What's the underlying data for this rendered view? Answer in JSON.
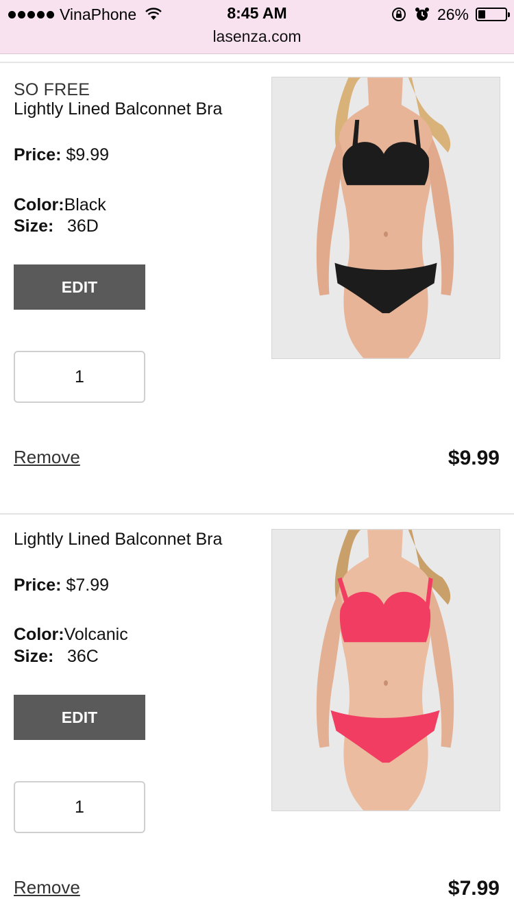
{
  "status_bar": {
    "carrier": "VinaPhone",
    "time": "8:45 AM",
    "battery": "26%",
    "battery_level": 0.26
  },
  "browser": {
    "url": "lasenza.com"
  },
  "cart": {
    "items": [
      {
        "brand": "SO FREE",
        "name": "Lightly Lined Balconnet Bra",
        "price_label": "Price:",
        "price": "$9.99",
        "color_label": "Color:",
        "color": "Black",
        "size_label": "Size:",
        "size": "36D",
        "edit_label": "EDIT",
        "quantity": "1",
        "remove_label": "Remove",
        "total": "$9.99",
        "garment_color": "#1c1c1c"
      },
      {
        "brand": "",
        "name": "Lightly Lined Balconnet Bra",
        "price_label": "Price:",
        "price": "$7.99",
        "color_label": "Color:",
        "color": "Volcanic",
        "size_label": "Size:",
        "size": "36C",
        "edit_label": "EDIT",
        "quantity": "1",
        "remove_label": "Remove",
        "total": "$7.99",
        "garment_color": "#f23d63"
      }
    ]
  }
}
